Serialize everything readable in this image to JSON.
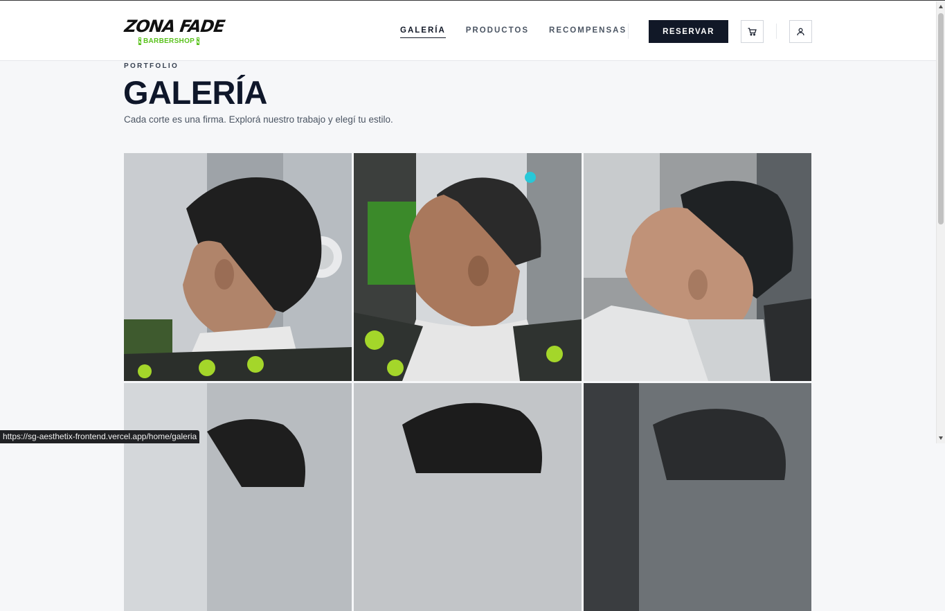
{
  "brand": {
    "name": "ZONA FADE",
    "tagline": "BARBERSHOP"
  },
  "nav": {
    "items": [
      {
        "label": "GALERÍA",
        "active": true
      },
      {
        "label": "PRODUCTOS",
        "active": false
      },
      {
        "label": "RECOMPENSAS",
        "active": false
      }
    ],
    "cta_label": "RESERVAR",
    "cart_icon": "cart-icon",
    "user_icon": "user-icon"
  },
  "hero": {
    "eyebrow": "PORTFOLIO",
    "title": "GALERÍA",
    "subtitle": "Cada corte es una firma. Explorá nuestro trabajo y elegí tu estilo."
  },
  "gallery": {
    "photos": [
      {
        "subject": "curly-top-fade-side-view"
      },
      {
        "subject": "buzz-cut-fade-side-view"
      },
      {
        "subject": "textured-top-taper-fade-side-view"
      },
      {
        "subject": "haircut-photo-4"
      },
      {
        "subject": "haircut-photo-5"
      },
      {
        "subject": "haircut-photo-6"
      }
    ]
  },
  "status_bar": {
    "url": "https://sg-aesthetix-frontend.vercel.app/home/galeria"
  },
  "colors": {
    "dark": "#111827",
    "accent_green": "#5ac21c",
    "background": "#f6f7f9"
  }
}
